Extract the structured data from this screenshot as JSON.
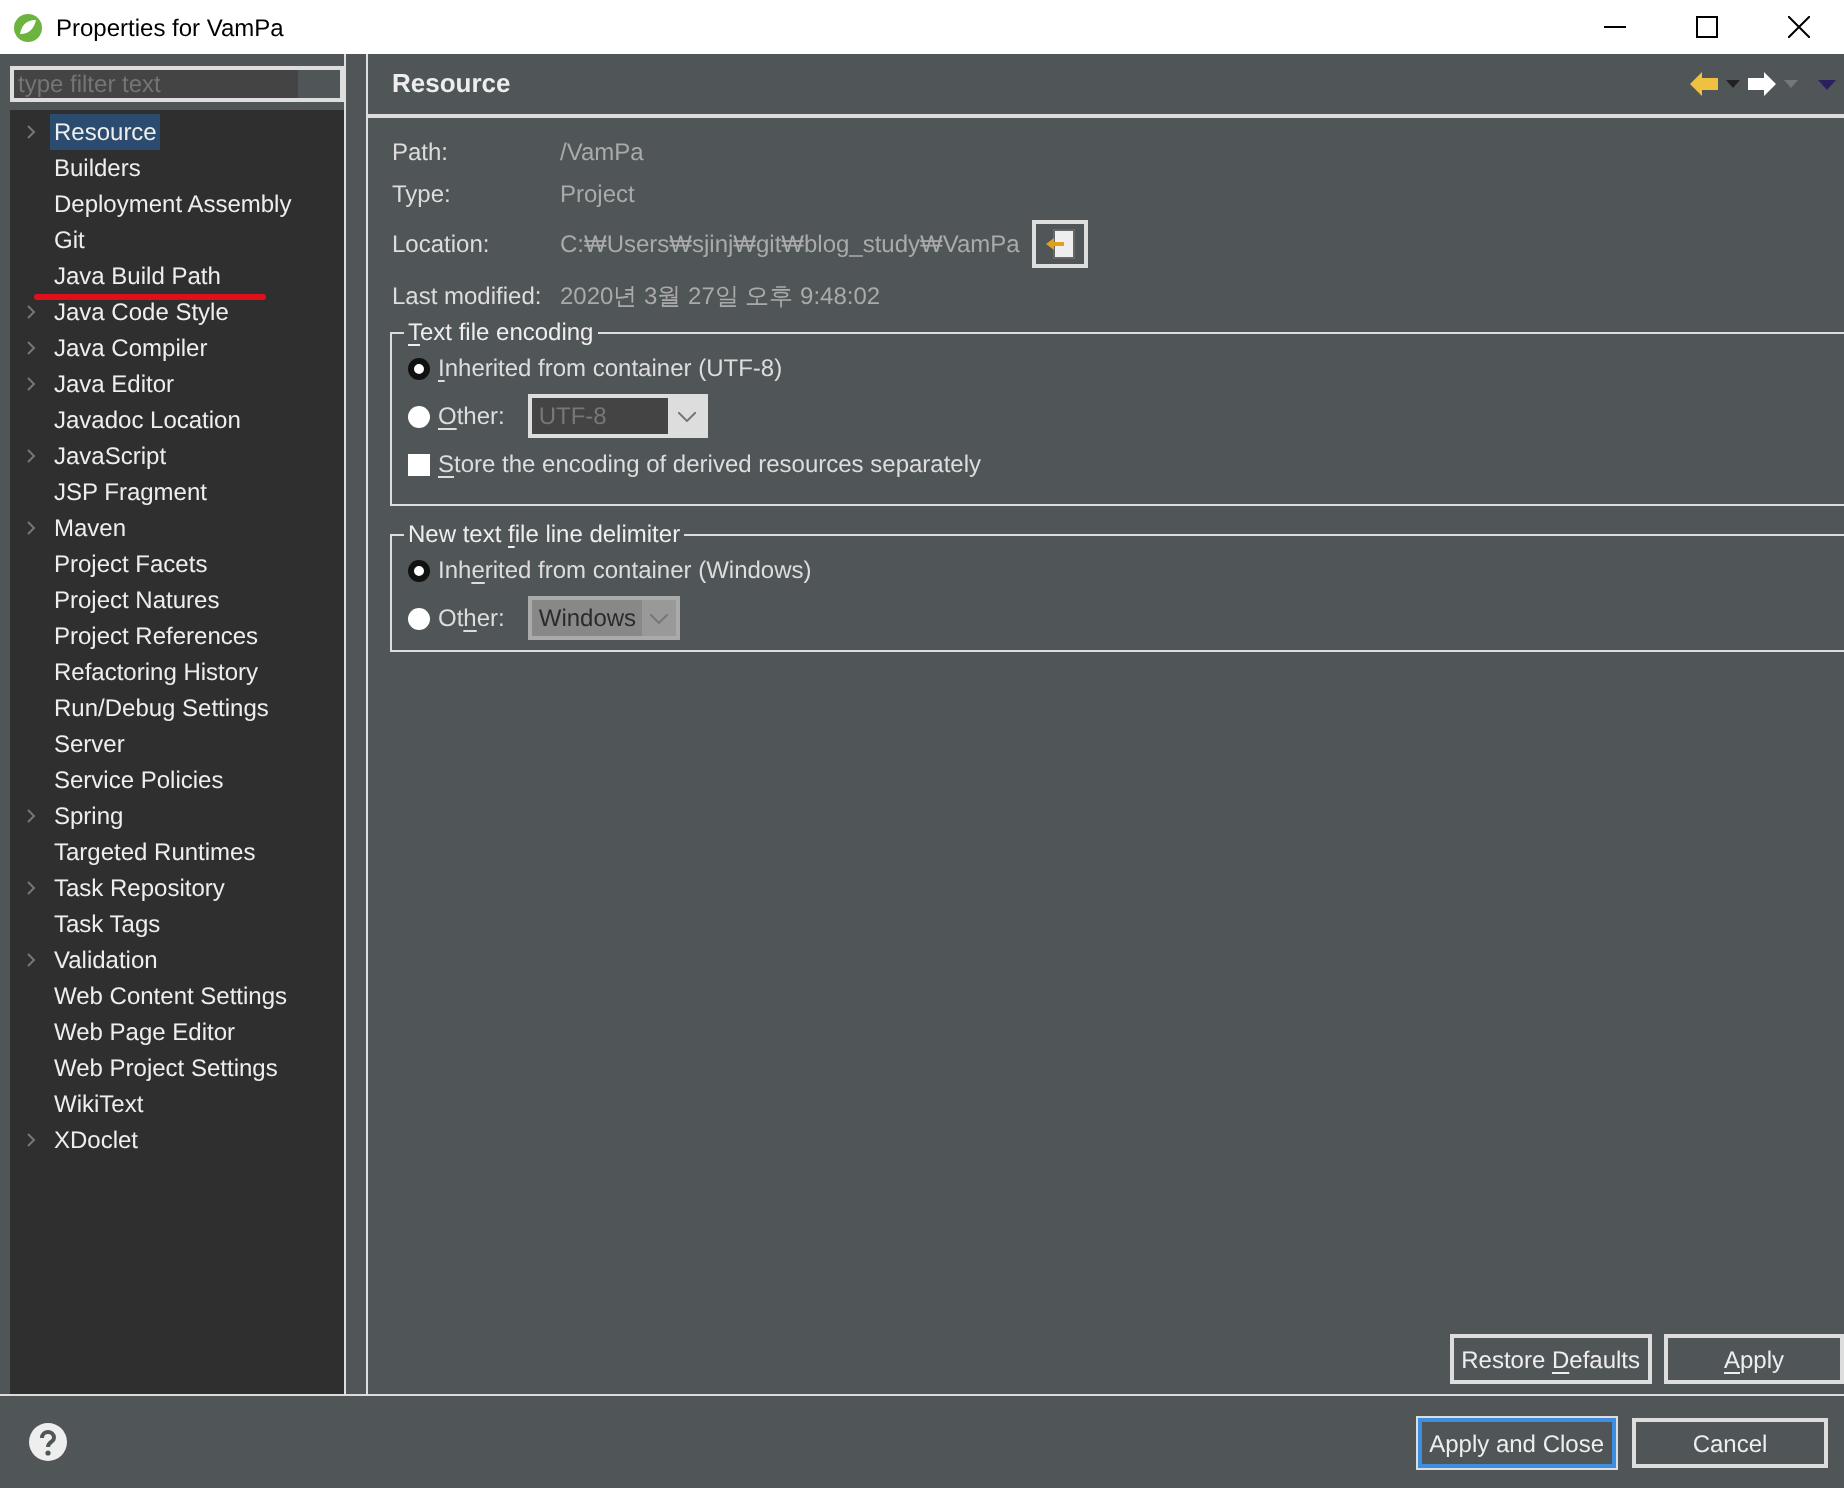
{
  "window": {
    "title": "Properties for VamPa"
  },
  "filter": {
    "placeholder": "type filter text"
  },
  "tree": [
    {
      "label": "Resource",
      "expandable": true,
      "selected": true,
      "annotated": false
    },
    {
      "label": "Builders",
      "expandable": false,
      "selected": false,
      "annotated": false
    },
    {
      "label": "Deployment Assembly",
      "expandable": false,
      "selected": false,
      "annotated": false
    },
    {
      "label": "Git",
      "expandable": false,
      "selected": false,
      "annotated": false
    },
    {
      "label": "Java Build Path",
      "expandable": false,
      "selected": false,
      "annotated": true
    },
    {
      "label": "Java Code Style",
      "expandable": true,
      "selected": false,
      "annotated": false
    },
    {
      "label": "Java Compiler",
      "expandable": true,
      "selected": false,
      "annotated": false
    },
    {
      "label": "Java Editor",
      "expandable": true,
      "selected": false,
      "annotated": false
    },
    {
      "label": "Javadoc Location",
      "expandable": false,
      "selected": false,
      "annotated": false
    },
    {
      "label": "JavaScript",
      "expandable": true,
      "selected": false,
      "annotated": false
    },
    {
      "label": "JSP Fragment",
      "expandable": false,
      "selected": false,
      "annotated": false
    },
    {
      "label": "Maven",
      "expandable": true,
      "selected": false,
      "annotated": false
    },
    {
      "label": "Project Facets",
      "expandable": false,
      "selected": false,
      "annotated": false
    },
    {
      "label": "Project Natures",
      "expandable": false,
      "selected": false,
      "annotated": false
    },
    {
      "label": "Project References",
      "expandable": false,
      "selected": false,
      "annotated": false
    },
    {
      "label": "Refactoring History",
      "expandable": false,
      "selected": false,
      "annotated": false
    },
    {
      "label": "Run/Debug Settings",
      "expandable": false,
      "selected": false,
      "annotated": false
    },
    {
      "label": "Server",
      "expandable": false,
      "selected": false,
      "annotated": false
    },
    {
      "label": "Service Policies",
      "expandable": false,
      "selected": false,
      "annotated": false
    },
    {
      "label": "Spring",
      "expandable": true,
      "selected": false,
      "annotated": false
    },
    {
      "label": "Targeted Runtimes",
      "expandable": false,
      "selected": false,
      "annotated": false
    },
    {
      "label": "Task Repository",
      "expandable": true,
      "selected": false,
      "annotated": false
    },
    {
      "label": "Task Tags",
      "expandable": false,
      "selected": false,
      "annotated": false
    },
    {
      "label": "Validation",
      "expandable": true,
      "selected": false,
      "annotated": false
    },
    {
      "label": "Web Content Settings",
      "expandable": false,
      "selected": false,
      "annotated": false
    },
    {
      "label": "Web Page Editor",
      "expandable": false,
      "selected": false,
      "annotated": false
    },
    {
      "label": "Web Project Settings",
      "expandable": false,
      "selected": false,
      "annotated": false
    },
    {
      "label": "WikiText",
      "expandable": false,
      "selected": false,
      "annotated": false
    },
    {
      "label": "XDoclet",
      "expandable": true,
      "selected": false,
      "annotated": false
    }
  ],
  "page": {
    "title": "Resource",
    "info": [
      {
        "label": "Path:",
        "value": "/VamPa"
      },
      {
        "label": "Type:",
        "value": "Project"
      },
      {
        "label": "Location:",
        "value": "C:₩Users₩sjinj₩git₩blog_study₩VamPa",
        "kind": "path"
      },
      {
        "label": "Last modified:",
        "value": "2020년 3월 27일 오후 9:48:02"
      }
    ],
    "groups": [
      {
        "title": {
          "key": "T",
          "after": "ext file encoding"
        },
        "options": [
          {
            "kind": "radio",
            "label": {
              "key": "I",
              "after": "nherited from container (UTF-8)"
            },
            "selected": true
          },
          {
            "kind": "radio",
            "label": {
              "key": "O",
              "after": "ther:"
            },
            "selected": false,
            "combo": "UTF-8"
          },
          {
            "kind": "checkbox",
            "label": {
              "key": "S",
              "after": "tore the encoding of derived resources separately"
            },
            "checked": false
          }
        ]
      },
      {
        "title": {
          "before": "New text ",
          "key": "f",
          "after": "ile line delimiter"
        },
        "options": [
          {
            "kind": "radio",
            "label": {
              "before": "Inh",
              "key": "e",
              "after": "rited from container (Windows)"
            },
            "selected": true
          },
          {
            "kind": "radio",
            "label": {
              "before": "Ot",
              "key": "h",
              "after": "er:"
            },
            "selected": false,
            "combo": "Windows"
          }
        ]
      }
    ],
    "buttons": [
      {
        "before": "Restore ",
        "key": "D",
        "after": "efaults"
      },
      {
        "key": "A",
        "after": "pply"
      }
    ]
  },
  "footer": {
    "buttons": [
      {
        "label": "Apply and Close",
        "default": true
      },
      {
        "label": "Cancel",
        "default": false
      }
    ]
  }
}
